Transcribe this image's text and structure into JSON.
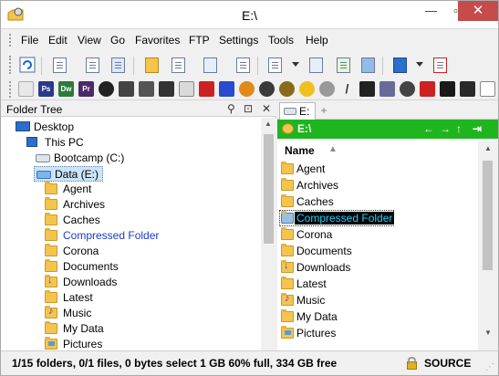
{
  "window": {
    "title": "E:\\",
    "minimize": "—",
    "maximize": "▫",
    "close": "✕"
  },
  "menu": [
    "File",
    "Edit",
    "View",
    "Go",
    "Favorites",
    "FTP",
    "Settings",
    "Tools",
    "Help"
  ],
  "toolbar2_icons": [
    {
      "name": "photoshop-icon",
      "label": "Ps",
      "color": "#2a3a8a"
    },
    {
      "name": "dreamweaver-icon",
      "label": "Dw",
      "color": "#2e7a3a"
    },
    {
      "name": "premiere-icon",
      "label": "Pr",
      "color": "#4b2a6a"
    }
  ],
  "left_pane": {
    "title": "Folder Tree",
    "tree": {
      "desktop": "Desktop",
      "this_pc": "This PC",
      "bootcamp": "Bootcamp (C:)",
      "data_drive": "Data (E:)",
      "folders": [
        "Agent",
        "Archives",
        "Caches",
        "Compressed Folder",
        "Corona",
        "Documents",
        "Downloads",
        "Latest",
        "Music",
        "My Data",
        "Pictures"
      ]
    }
  },
  "right_pane": {
    "tab_label": "E:",
    "tab_add": "+",
    "path": "E:\\",
    "column_name": "Name",
    "files": [
      "Agent",
      "Archives",
      "Caches",
      "Compressed Folder",
      "Corona",
      "Documents",
      "Downloads",
      "Latest",
      "Music",
      "My Data",
      "Pictures"
    ],
    "selected_file": "Compressed Folder"
  },
  "status": {
    "text": "1/15 folders, 0/1 files, 0 bytes select  1 GB  60% full, 334 GB free",
    "source": "SOURCE"
  },
  "colors": {
    "path_bar": "#1fb51f",
    "selection_text": "#1fd0ff",
    "compressed_folder": "#1a3ad0"
  }
}
